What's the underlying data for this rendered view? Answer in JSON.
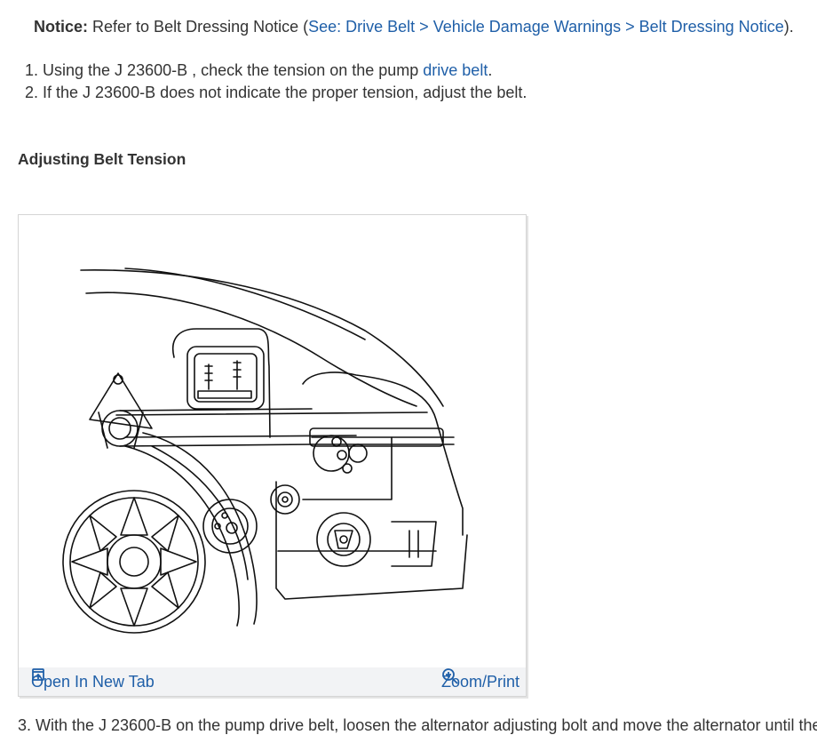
{
  "notice": {
    "label": "Notice:",
    "text_before": "Refer to Belt Dressing Notice (",
    "link": "See: Drive Belt > Vehicle Damage Warnings > Belt Dressing Notice",
    "text_after": ")."
  },
  "steps": [
    {
      "num": "1.",
      "before": "Using the J 23600-B , check the tension on the pump ",
      "link": "drive belt",
      "after": "."
    },
    {
      "num": "2.",
      "text": "If the J 23600-B does not indicate the proper tension, adjust the belt."
    }
  ],
  "section_heading": "Adjusting Belt Tension",
  "figure": {
    "open_label": "Open In New Tab",
    "zoom_label": "Zoom/Print",
    "open_icon": "open-new-tab-icon",
    "zoom_icon": "zoom-in-icon"
  },
  "next_step_partial": "3. With the J 23600-B on the pump drive belt, loosen the alternator adjusting bolt and move the alternator until the"
}
